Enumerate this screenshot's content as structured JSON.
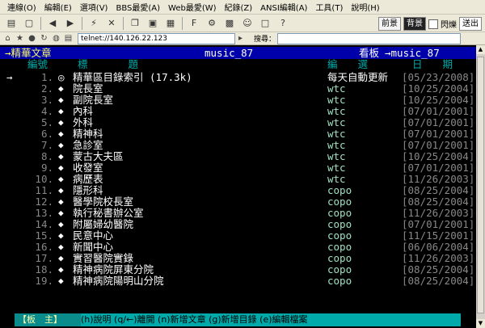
{
  "menus": [
    "連線(O)",
    "編輯(E)",
    "選項(V)",
    "BBS最愛(A)",
    "Web最愛(W)",
    "紀錄(Z)",
    "ANSI編輯(A)",
    "工具(T)",
    "說明(H)"
  ],
  "toolbar_right": {
    "toggle_a": "前景",
    "toggle_b": "背景",
    "checkbox_label": "閃爍",
    "select_label": "送出"
  },
  "address": {
    "value": "telnet://140.126.22.123",
    "search_label": "搜尋："
  },
  "header": {
    "left": "→精華文章",
    "center": "music_87",
    "right_label": "看板",
    "right_board": "→music_87"
  },
  "columns": {
    "num": "編號",
    "title": "標　　　　題",
    "editor": "編　　選",
    "date": "日　　期"
  },
  "cursor": "→",
  "rows": [
    {
      "num": "1.",
      "mark": "◎",
      "title": "精華區目錄索引 (17.3k)",
      "editor": "每天自動更新",
      "date": "[05/23/2008]"
    },
    {
      "num": "2.",
      "mark": "◆",
      "title": "院長室",
      "editor": "wtc",
      "date": "[10/25/2004]"
    },
    {
      "num": "3.",
      "mark": "◆",
      "title": "副院長室",
      "editor": "wtc",
      "date": "[10/25/2004]"
    },
    {
      "num": "4.",
      "mark": "◆",
      "title": "內科",
      "editor": "wtc",
      "date": "[07/01/2001]"
    },
    {
      "num": "5.",
      "mark": "◆",
      "title": "外科",
      "editor": "wtc",
      "date": "[07/01/2001]"
    },
    {
      "num": "6.",
      "mark": "◆",
      "title": "精神科",
      "editor": "wtc",
      "date": "[07/01/2001]"
    },
    {
      "num": "7.",
      "mark": "◆",
      "title": "急診室",
      "editor": "wtc",
      "date": "[07/01/2001]"
    },
    {
      "num": "8.",
      "mark": "◆",
      "title": "蒙古大夫區",
      "editor": "wtc",
      "date": "[10/25/2004]"
    },
    {
      "num": "9.",
      "mark": "◆",
      "title": "收發室",
      "editor": "wtc",
      "date": "[07/01/2001]"
    },
    {
      "num": "10.",
      "mark": "◆",
      "title": "病歷表",
      "editor": "wtc",
      "date": "[11/26/2003]"
    },
    {
      "num": "11.",
      "mark": "◆",
      "title": "隱形科",
      "editor": "copo",
      "date": "[08/25/2004]"
    },
    {
      "num": "12.",
      "mark": "◆",
      "title": "醫學院校長室",
      "editor": "copo",
      "date": "[08/25/2004]"
    },
    {
      "num": "13.",
      "mark": "◆",
      "title": "執行秘書辦公室",
      "editor": "copo",
      "date": "[11/26/2003]"
    },
    {
      "num": "14.",
      "mark": "◆",
      "title": "附屬婦幼醫院",
      "editor": "copo",
      "date": "[07/01/2001]"
    },
    {
      "num": "15.",
      "mark": "◆",
      "title": "民意中心",
      "editor": "copo",
      "date": "[11/15/2001]"
    },
    {
      "num": "16.",
      "mark": "◆",
      "title": "新聞中心",
      "editor": "copo",
      "date": "[06/06/2004]"
    },
    {
      "num": "17.",
      "mark": "◆",
      "title": "實習醫院實錄",
      "editor": "copo",
      "date": "[11/26/2003]"
    },
    {
      "num": "18.",
      "mark": "◆",
      "title": "精神病院屏東分院",
      "editor": "copo",
      "date": "[08/25/2004]"
    },
    {
      "num": "19.",
      "mark": "◆",
      "title": "精神病院陽明山分院",
      "editor": "copo",
      "date": "[08/25/2004]"
    }
  ],
  "footer": {
    "board": "【板　主】",
    "keys": "(h)說明  (q/←)離開  (n)新增文章  (g)新增目錄  (e)編輯檔案"
  },
  "colors": {
    "terminal_bg": "#000000",
    "header_bg": "#0000aa",
    "footer_bg": "#00aaaa",
    "accent_red": "#cc3333"
  }
}
